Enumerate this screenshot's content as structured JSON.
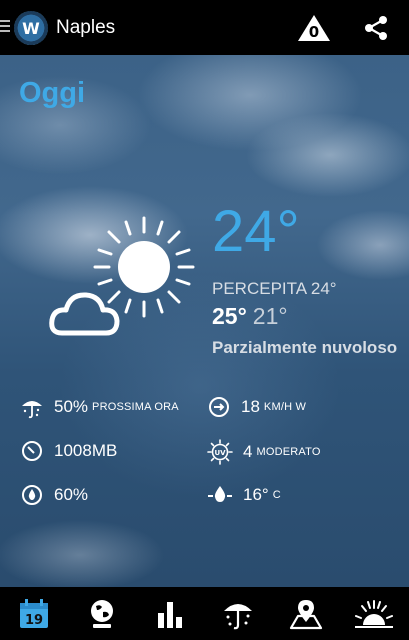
{
  "header": {
    "city": "Naples",
    "alert_count": "0"
  },
  "main": {
    "day_label": "Oggi",
    "temp_now": "24°",
    "feels_like": "PERCEPITA 24°",
    "temp_max": "25°",
    "temp_min": "21°",
    "condition": "Parzialmente nuvoloso",
    "icon": "partly-cloudy-icon"
  },
  "stats": {
    "precip_value": "50%",
    "precip_unit": "PROSSIMA ORA",
    "wind_value": "18",
    "wind_unit": "KM/H W",
    "pressure_value": "1008MB",
    "uv_value": "4",
    "uv_unit": "MODERATO",
    "humidity_value": "60%",
    "dewpoint_value": "16°",
    "dewpoint_unit": "C"
  },
  "bottom_nav": {
    "calendar_day": "19",
    "items": [
      "calendar-icon",
      "globe-icon",
      "bar-chart-icon",
      "rain-umbrella-icon",
      "map-pin-icon",
      "sunrise-icon"
    ]
  },
  "colors": {
    "accent": "#3fa9e6",
    "bar": "#000000",
    "calendar_active": "#3fa9e6"
  }
}
